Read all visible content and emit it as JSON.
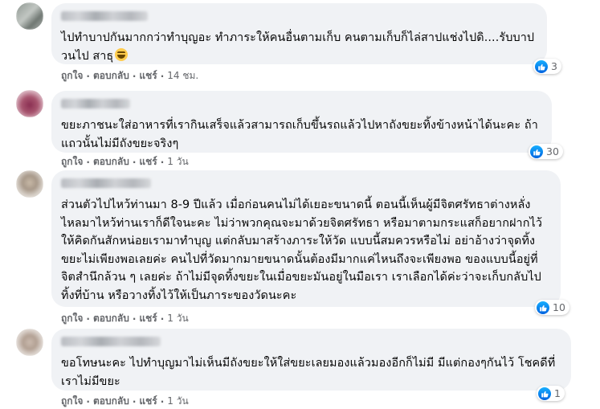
{
  "colors": {
    "bubble": "#f0f2f5",
    "action_text": "#65676b",
    "like_blue": "#1877f2"
  },
  "comments": [
    {
      "text": "ไปทำบาปกันมากกว่าทำบุญอะ ทำภาระให้คนอื่นตามเก็บ คนตามเก็บก็ไล่สาปแช่งไปดิ....รับบาปวนไป สาธุ",
      "emoji": "rofl-emoji",
      "actions": {
        "like": "ถูกใจ",
        "reply": "ตอบกลับ",
        "share": "แชร์",
        "time": "14 ชม."
      },
      "reactions": "3"
    },
    {
      "text": "ขยะภาชนะใส่อาหารที่เรากินเสร็จแล้วสามารถเก็บขึ้นรถแล้วไปหาถังขยะทิ้งข้างหน้าได้นะคะ ถ้าแถวนั้นไม่มีถังขยะจริงๆ",
      "actions": {
        "like": "ถูกใจ",
        "reply": "ตอบกลับ",
        "share": "แชร์",
        "time": "1 วัน"
      },
      "reactions": "30"
    },
    {
      "text": "ส่วนตัวไปไหว้ท่านมา 8-9 ปีแล้ว เมื่อก่อนคนไม่ได้เยอะขนาดนี้ ตอนนี้เห็นผู้มีจิตศรัทธาต่างหลั่งไหลมาไหว้ท่านเราก็ดีใจนะคะ ไม่ว่าพวกคุณจะมาด้วยจิตศรัทธา หรือมาตามกระแสก็อยากฝากไว้ให้คิดกันสักหน่อยเรามาทำบุญ แต่กลับมาสร้างภาระให้วัด แบบนี้สมควรหรือไม่ อย่าอ้างว่าจุดทิ้งขยะไม่เพียงพอเลยค่ะ คนไปที่วัดมากมายขนาดนั้นต้องมีมากแค่ไหนถึงจะเพียงพอ ของแบบนี้อยู่ที่จิตสำนึกล้วน ๆ เลยค่ะ ถ้าไม่มีจุดทิ้งขยะในเมื่อขยะมันอยู่ในมือเรา เราเลือกได้ค่ะว่าจะเก็บกลับไปทิ้งที่บ้าน หรือวางทิ้งไว้ให้เป็นภาระของวัดนะคะ",
      "actions": {
        "like": "ถูกใจ",
        "reply": "ตอบกลับ",
        "share": "แชร์",
        "time": "1 วัน"
      },
      "reactions": "10"
    },
    {
      "text": "ขอโทษนะคะ ไปทำบุญมาไม่เห็นมีถังขยะให้ใส่ขยะเลยมองแล้วมองอีกก็ไม่มี มีแต่กองๆกันไว้ โชคดีที่เราไม่มีขยะ",
      "actions": {
        "like": "ถูกใจ",
        "reply": "ตอบกลับ",
        "share": "แชร์",
        "time": "1 วัน"
      },
      "reactions": "1"
    }
  ],
  "sep": "·"
}
